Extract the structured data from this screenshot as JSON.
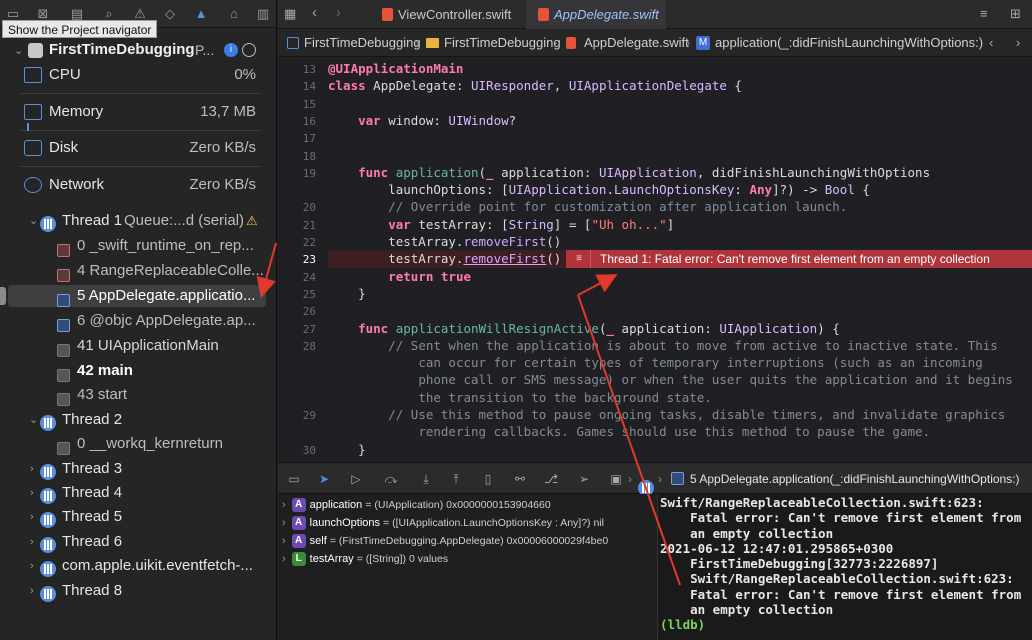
{
  "navigator": {
    "tooltip": "Show the Project navigator",
    "project": {
      "name": "FirstTimeDebugging",
      "suffix": "P..."
    },
    "gauges": [
      {
        "label": "CPU",
        "value": "0%"
      },
      {
        "label": "Memory",
        "value": "13,7 MB"
      },
      {
        "label": "Disk",
        "value": "Zero KB/s"
      },
      {
        "label": "Network",
        "value": "Zero KB/s"
      }
    ],
    "thread1": {
      "label": "Thread 1",
      "queue": "Queue:...d (serial)"
    },
    "frames": [
      {
        "label": "0 _swift_runtime_on_rep...",
        "style": "red"
      },
      {
        "label": "4 RangeReplaceableColle...",
        "style": "red"
      },
      {
        "label": "5 AppDelegate.applicatio...",
        "style": "blue",
        "selected": true
      },
      {
        "label": "6 @objc AppDelegate.ap...",
        "style": "blue"
      },
      {
        "label": "41 UIApplicationMain",
        "style": "gray"
      },
      {
        "label": "42 main",
        "style": "gray"
      },
      {
        "label": "43 start",
        "style": "gray"
      }
    ],
    "thread2": {
      "label": "Thread 2",
      "frame": "0 __workq_kernreturn"
    },
    "other_threads": [
      "Thread 3",
      "Thread 4",
      "Thread 5",
      "Thread 6",
      "com.apple.uikit.eventfetch-...",
      "Thread 8"
    ]
  },
  "tabs": [
    {
      "label": "ViewController.swift"
    },
    {
      "label": "AppDelegate.swift"
    }
  ],
  "jumpbar": [
    "FirstTimeDebugging",
    "FirstTimeDebugging",
    "AppDelegate.swift",
    "application(_:didFinishLaunchingWithOptions:)"
  ],
  "editor": {
    "lines": [
      {
        "n": "13",
        "html": "<span class=\"kw\">@UIApplicationMain</span>"
      },
      {
        "n": "14",
        "html": "<span class=\"kw\">class</span> AppDelegate: <span class=\"ty\">UIResponder</span>, <span class=\"ty\">UIApplicationDelegate</span> {"
      },
      {
        "n": "15",
        "html": ""
      },
      {
        "n": "16",
        "html": "    <span class=\"kw\">var</span> window: <span class=\"ty\">UIWindow</span>?"
      },
      {
        "n": "17",
        "html": ""
      },
      {
        "n": "18",
        "html": ""
      },
      {
        "n": "19",
        "html": "    <span class=\"kw\">func</span> <span class=\"fn\">application</span>(<span class=\"kw\">_</span> application: <span class=\"ty\">UIApplication</span>, didFinishLaunchingWithOptions"
      },
      {
        "n": "",
        "html": "        launchOptions: [<span class=\"ty\">UIApplication</span>.<span class=\"ty\">LaunchOptionsKey</span>: <span class=\"kw\">Any</span>]?) -> <span class=\"ty\">Bool</span> {"
      },
      {
        "n": "20",
        "html": "        <span class=\"cm\">// Override point for customization after application launch.</span>"
      },
      {
        "n": "21",
        "html": "        <span class=\"kw\">var</span> testArray: [<span class=\"ty\">String</span>] = [<span class=\"st\">\"Uh oh...\"</span>]"
      },
      {
        "n": "22",
        "html": "        testArray.<span class=\"pr\">removeFirst</span>()"
      },
      {
        "n": "23",
        "html": "        testArray.<span class=\"pr\" style=\"text-decoration:underline\">removeFirst</span>()"
      },
      {
        "n": "24",
        "html": "        <span class=\"kw\">return</span> <span class=\"kw\">true</span>"
      },
      {
        "n": "25",
        "html": "    }"
      },
      {
        "n": "26",
        "html": ""
      },
      {
        "n": "27",
        "html": "    <span class=\"kw\">func</span> <span class=\"fn\">applicationWillResignActive</span>(<span class=\"kw\">_</span> application: <span class=\"ty\">UIApplication</span>) {"
      },
      {
        "n": "28",
        "html": "        <span class=\"cm\">// Sent when the application is about to move from active to inactive state. This</span>"
      },
      {
        "n": "",
        "html": "            <span class=\"cm\">can occur for certain types of temporary interruptions (such as an incoming</span>"
      },
      {
        "n": "",
        "html": "            <span class=\"cm\">phone call or SMS message) or when the user quits the application and it begins</span>"
      },
      {
        "n": "",
        "html": "            <span class=\"cm\">the transition to the background state.</span>"
      },
      {
        "n": "29",
        "html": "        <span class=\"cm\">// Use this method to pause ongoing tasks, disable timers, and invalidate graphics</span>"
      },
      {
        "n": "",
        "html": "            <span class=\"cm\">rendering callbacks. Games should use this method to pause the game.</span>"
      },
      {
        "n": "30",
        "html": "    }"
      }
    ],
    "error_banner": "Thread 1: Fatal error: Can't remove first element from an empty collection"
  },
  "debugbar": {
    "breadcrumb": "5 AppDelegate.application(_:didFinishLaunchingWithOptions:)"
  },
  "variables": [
    {
      "badge": "A",
      "name": "application",
      "value": "= (UIApplication) 0x0000000153904660",
      "color": "#6e4ab5"
    },
    {
      "badge": "A",
      "name": "launchOptions",
      "value": "= ([UIApplication.LaunchOptionsKey : Any]?) nil",
      "color": "#6e4ab5"
    },
    {
      "badge": "A",
      "name": "self",
      "value": "= (FirstTimeDebugging.AppDelegate) 0x00006000029f4be0",
      "color": "#6e4ab5"
    },
    {
      "badge": "L",
      "name": "testArray",
      "value": "= ([String]) 0 values",
      "color": "#3d8a3a"
    }
  ],
  "console": {
    "lines": [
      "Swift/RangeReplaceableCollection.swift:623:",
      "    Fatal error: Can't remove first element from",
      "    an empty collection",
      "2021-06-12 12:47:01.295865+0300",
      "    FirstTimeDebugging[32773:2226897]",
      "    Swift/RangeReplaceableCollection.swift:623:",
      "    Fatal error: Can't remove first element from",
      "    an empty collection"
    ],
    "prompt": "(lldb)"
  },
  "colors": {
    "error": "#b0353b",
    "accent": "#5a8fe0",
    "arrow": "#e0392d"
  }
}
